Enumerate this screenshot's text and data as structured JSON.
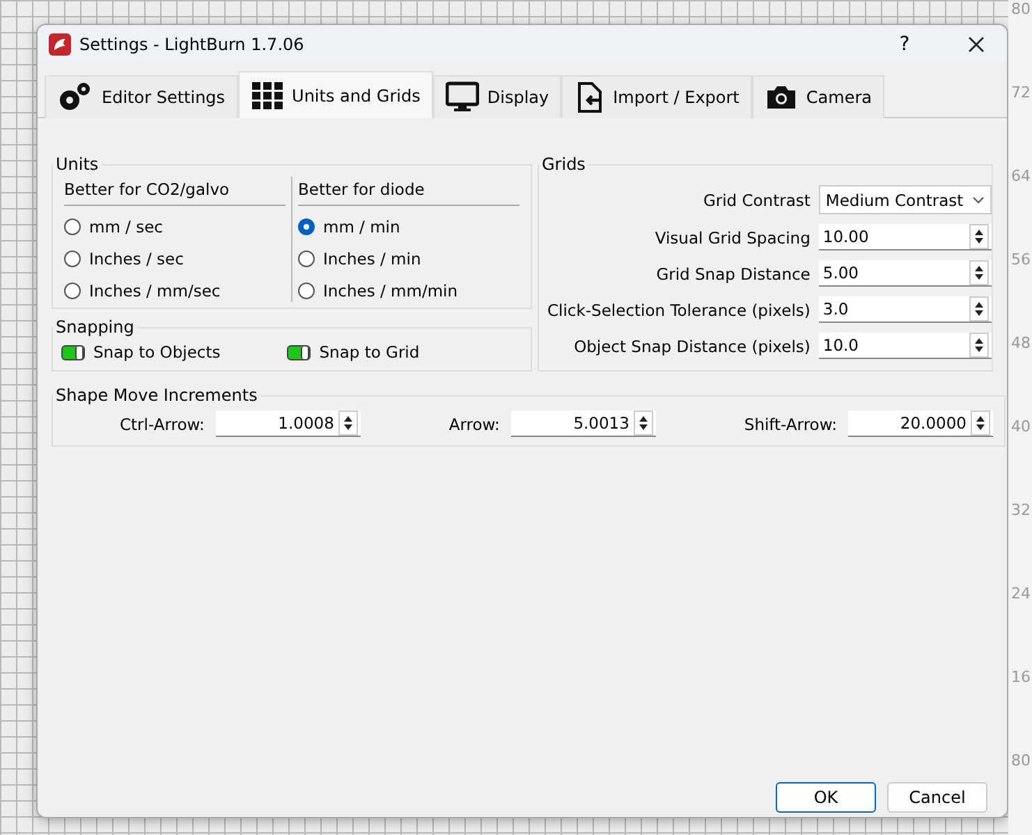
{
  "window": {
    "title": "Settings - LightBurn 1.7.06",
    "help": "?"
  },
  "tabs": [
    {
      "label": "Editor Settings",
      "selected": false
    },
    {
      "label": "Units and Grids",
      "selected": true
    },
    {
      "label": "Display",
      "selected": false
    },
    {
      "label": "Import / Export",
      "selected": false
    },
    {
      "label": "Camera",
      "selected": false
    }
  ],
  "units": {
    "title": "Units",
    "columns": [
      {
        "heading": "Better for CO2/galvo",
        "options": [
          {
            "label": "mm / sec",
            "selected": false
          },
          {
            "label": "Inches / sec",
            "selected": false
          },
          {
            "label": "Inches / mm/sec",
            "selected": false
          }
        ]
      },
      {
        "heading": "Better for diode",
        "options": [
          {
            "label": "mm / min",
            "selected": true
          },
          {
            "label": "Inches / min",
            "selected": false
          },
          {
            "label": "Inches / mm/min",
            "selected": false
          }
        ]
      }
    ]
  },
  "snapping": {
    "title": "Snapping",
    "items": [
      {
        "label": "Snap to Objects",
        "on": true
      },
      {
        "label": "Snap to Grid",
        "on": true
      }
    ]
  },
  "grids": {
    "title": "Grids",
    "fields": [
      {
        "kind": "dropdown",
        "label": "Grid Contrast",
        "value": "Medium Contrast"
      },
      {
        "kind": "spinner",
        "label": "Visual Grid Spacing",
        "value": "10.00"
      },
      {
        "kind": "spinner",
        "label": "Grid Snap Distance",
        "value": "5.00"
      },
      {
        "kind": "spinner",
        "label": "Click-Selection Tolerance (pixels)",
        "value": "3.0"
      },
      {
        "kind": "spinner",
        "label": "Object Snap Distance (pixels)",
        "value": "10.0"
      }
    ]
  },
  "shape_move": {
    "title": "Shape Move Increments",
    "fields": [
      {
        "label": "Ctrl-Arrow:",
        "value": "1.0008"
      },
      {
        "label": "Arrow:",
        "value": "5.0013"
      },
      {
        "label": "Shift-Arrow:",
        "value": "20.0000"
      }
    ]
  },
  "buttons": [
    {
      "label": "OK",
      "default": true
    },
    {
      "label": "Cancel",
      "default": false
    }
  ],
  "ruler": {
    "labels": [
      "80",
      "72",
      "64",
      "56",
      "48",
      "40",
      "32",
      "24",
      "16",
      "80"
    ]
  }
}
